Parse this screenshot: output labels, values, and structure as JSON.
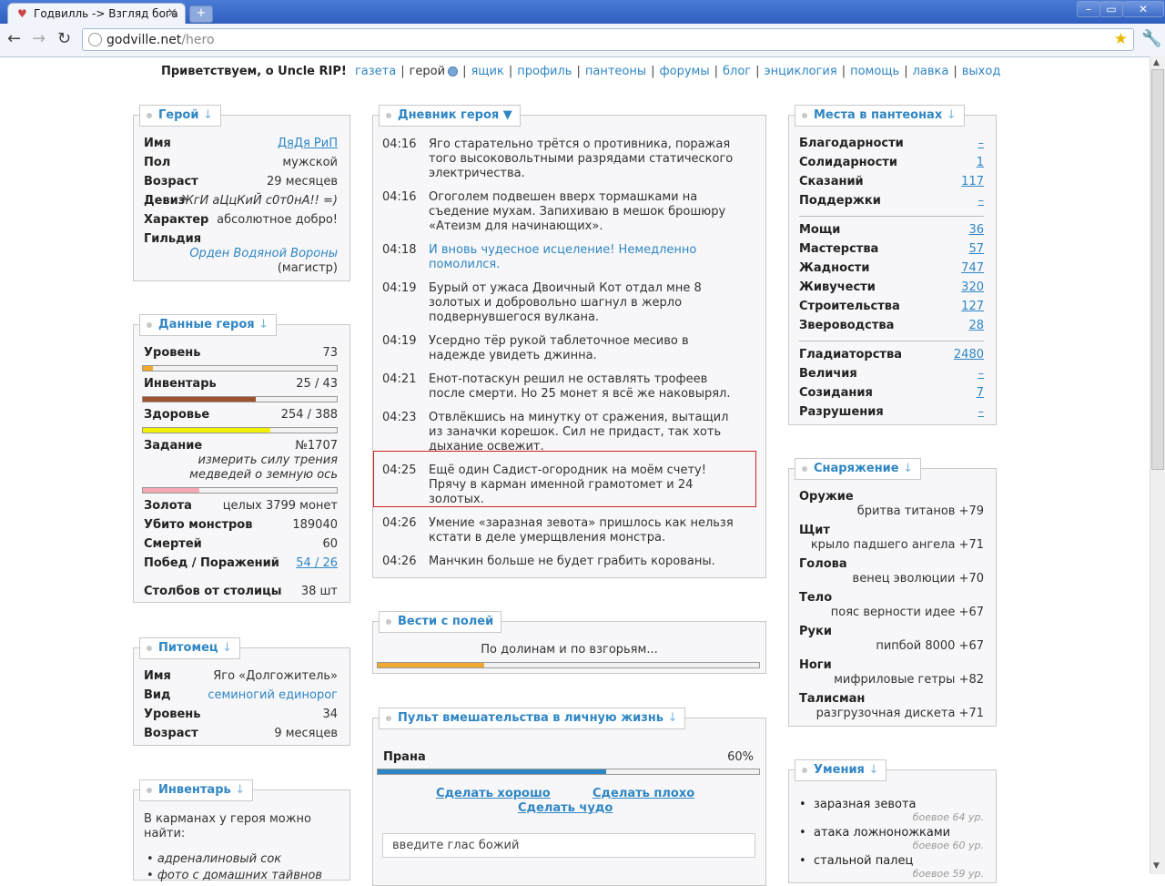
{
  "browser": {
    "tab_title": "Годвилль -> Взгляд бога",
    "url_host": "godville.net",
    "url_path": "/hero",
    "new_tab": "+",
    "minimize": "–",
    "maximize": "▭",
    "close": "✕"
  },
  "topnav": {
    "greeting": "Приветствуем, о Uncle RIP!",
    "items": [
      "газета",
      "герой",
      "ящик",
      "профиль",
      "пантеоны",
      "форумы",
      "блог",
      "энциклогия",
      "помощь",
      "лавка",
      "выход"
    ]
  },
  "hero": {
    "title": "Герой",
    "arrow": "↓",
    "rows": [
      {
        "label": "Имя",
        "value": "ДяДя РиП"
      },
      {
        "label": "Пол",
        "value": "мужской"
      },
      {
        "label": "Возраст",
        "value": "29 месяцев"
      },
      {
        "label": "Девиз",
        "value": "ЖгИ аЦцКиЙ с0т0нА!! =)"
      },
      {
        "label": "Характер",
        "value": "абсолютное добро!"
      },
      {
        "label": "Гильдия",
        "value": "Орден Водяной Вороны",
        "extra": "(магистр)"
      }
    ]
  },
  "stats": {
    "title": "Данные героя",
    "level_label": "Уровень",
    "level": "73",
    "level_progress": 0.05,
    "inventory_label": "Инвентарь",
    "inventory": "25 / 43",
    "inventory_progress": 0.58,
    "health_label": "Здоровье",
    "health": "254 / 388",
    "health_progress": 0.655,
    "quest_label": "Задание",
    "quest_no": "№1707",
    "quest_line1": "измерить силу трения",
    "quest_line2": "медведей о земную ось",
    "quest_progress": 0.29,
    "gold_label": "Золота",
    "gold": "целых 3799 монет",
    "kills_label": "Убито монстров",
    "kills": "189040",
    "deaths_label": "Смертей",
    "deaths": "60",
    "wins_label": "Побед / Поражений",
    "wins": "54 / 26",
    "distance_label": "Столбов от столицы",
    "distance": "38 шт"
  },
  "pet": {
    "title": "Питомец",
    "rows": [
      {
        "label": "Имя",
        "value": "Яго «Долгожитель»"
      },
      {
        "label": "Вид",
        "value": "семиногий единорог"
      },
      {
        "label": "Уровень",
        "value": "34"
      },
      {
        "label": "Возраст",
        "value": "9 месяцев"
      }
    ]
  },
  "inventory": {
    "title": "Инвентарь",
    "intro": "В карманах у героя можно найти:",
    "items": [
      "адреналиновый сок",
      "фото с домашних тайвнов"
    ]
  },
  "diary": {
    "title": "Дневник героя",
    "arrow": "▼",
    "entries": [
      {
        "time": "04:16",
        "text": "Яго старательно трётся о противника, поражая того высоковольтными разрядами статического электричества."
      },
      {
        "time": "04:16",
        "text": "Огоголем подвешен вверх тормашками на съедение мухам. Запихиваю в мешок брошюру «Атеизм для начинающих»."
      },
      {
        "time": "04:18",
        "text": "И вновь чудесное исцеление! Немедленно помолился."
      },
      {
        "time": "04:19",
        "text": "Бурый от ужаса Двоичный Кот отдал мне 8 золотых и добровольно шагнул в жерло подвернувшегося вулкана."
      },
      {
        "time": "04:19",
        "text": "Усердно тёр рукой таблеточное месиво в надежде увидеть джинна."
      },
      {
        "time": "04:21",
        "text": "Енот-потаскун решил не оставлять трофеев после смерти. Но 25 монет я всё же наковырял."
      },
      {
        "time": "04:23",
        "text": "Отвлёкшись на минутку от сражения, вытащил из заначки корешок. Сил не придаст, так хоть дыхание освежит."
      },
      {
        "time": "04:25",
        "text": "Ещё один Садист-огородник на моём счету! Прячу в карман именной грамотомет и 24 золотых."
      },
      {
        "time": "04:26",
        "text": "Умение «заразная зевота» пришлось как нельзя кстати в деле умерщвления монстра."
      },
      {
        "time": "04:26",
        "text": "Манчкин больше не будет грабить корованы."
      }
    ]
  },
  "news": {
    "title": "Вести с полей",
    "text": "По долинам и по взгорьям...",
    "progress": 0.28
  },
  "remote": {
    "title": "Пульт вмешательства в личную жизнь",
    "prana_label": "Прана",
    "prana_percent": "60%",
    "prana_progress": 0.6,
    "good": "Сделать хорошо",
    "bad": "Сделать плохо",
    "miracle": "Сделать чудо",
    "voice_placeholder": "введите глас божий"
  },
  "pantheons": {
    "title": "Места в пантеонах",
    "groups": [
      [
        {
          "label": "Благодарности",
          "value": "–"
        },
        {
          "label": "Солидарности",
          "value": "1"
        },
        {
          "label": "Сказаний",
          "value": "117"
        },
        {
          "label": "Поддержки",
          "value": "–"
        }
      ],
      [
        {
          "label": "Мощи",
          "value": "36"
        },
        {
          "label": "Мастерства",
          "value": "57"
        },
        {
          "label": "Жадности",
          "value": "747"
        },
        {
          "label": "Живучести",
          "value": "320"
        },
        {
          "label": "Строительства",
          "value": "127"
        },
        {
          "label": "Звероводства",
          "value": "28"
        }
      ],
      [
        {
          "label": "Гладиаторства",
          "value": "2480"
        },
        {
          "label": "Величия",
          "value": "–"
        },
        {
          "label": "Созидания",
          "value": "7"
        },
        {
          "label": "Разрушения",
          "value": "–"
        }
      ]
    ]
  },
  "equipment": {
    "title": "Снаряжение",
    "items": [
      {
        "slot": "Оружие",
        "name": "бритва титанов +79"
      },
      {
        "slot": "Щит",
        "name": "крыло падшего ангела +71"
      },
      {
        "slot": "Голова",
        "name": "венец эволюции +70"
      },
      {
        "slot": "Тело",
        "name": "пояс верности идее +67"
      },
      {
        "slot": "Руки",
        "name": "пипбой 8000 +67"
      },
      {
        "slot": "Ноги",
        "name": "мифриловые гетры +82"
      },
      {
        "slot": "Талисман",
        "name": "разгрузочная дискета +71"
      }
    ]
  },
  "skills": {
    "title": "Умения",
    "items": [
      {
        "name": "заразная зевота",
        "level": "боевое 64 ур."
      },
      {
        "name": "атака ложноножками",
        "level": "боевое 60 ур."
      },
      {
        "name": "стальной палец",
        "level": "боевое 59 ур."
      }
    ]
  },
  "colors": {
    "link": "#2f86c4",
    "level_bar": "#f0a830",
    "inventory_bar": "#a0522d",
    "health_bar": "#f0f000",
    "quest_bar": "#f4a8b4",
    "prana_bar": "#2f86c4",
    "highlight": "#d02020"
  }
}
